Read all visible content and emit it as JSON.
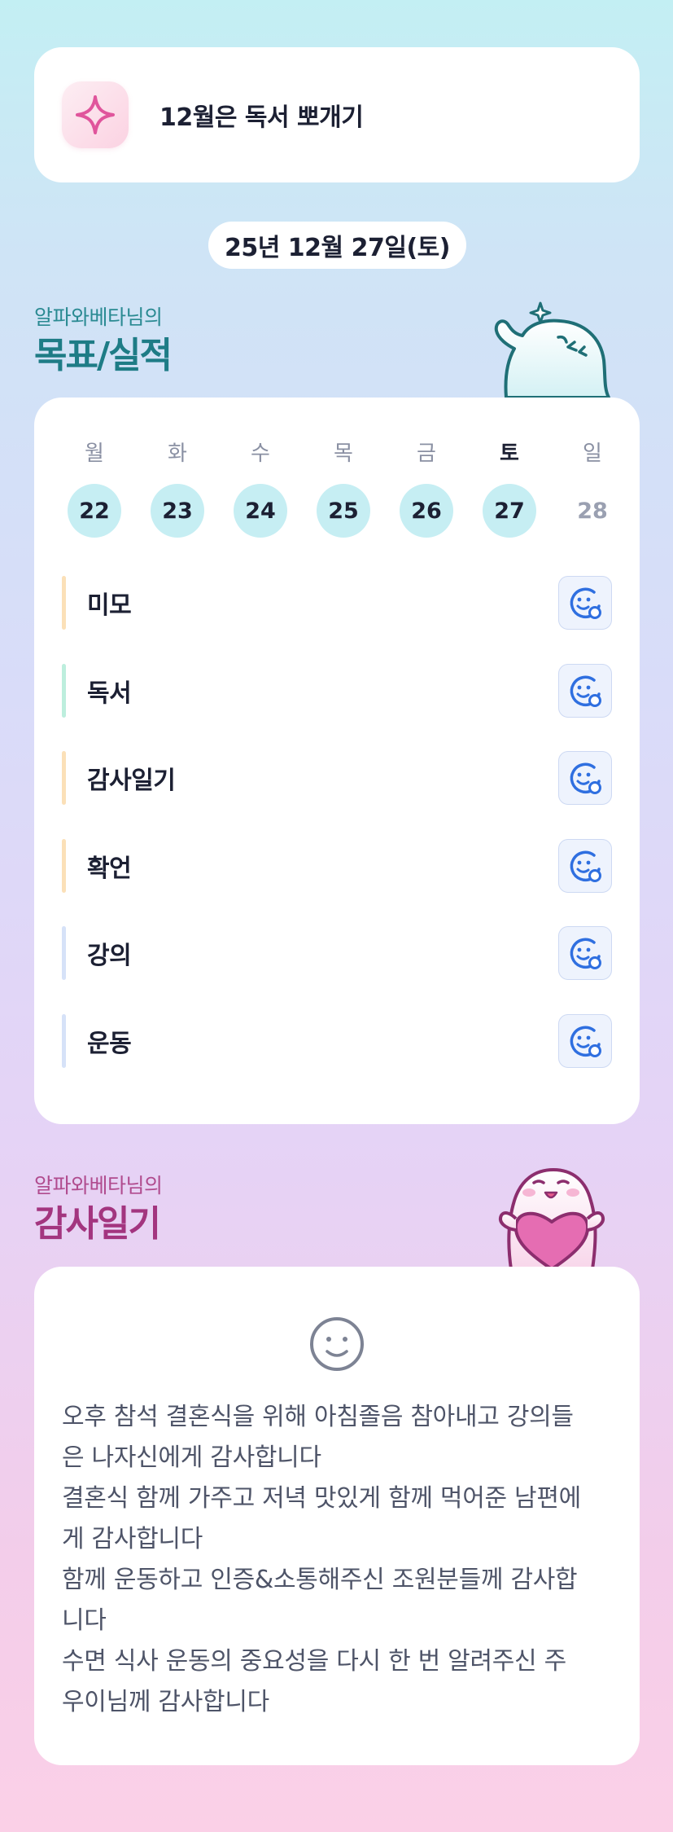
{
  "header": {
    "title": "12월은 독서 뽀개기",
    "icon": "sparkle-icon"
  },
  "date": "25년 12월 27일(토)",
  "goals_section": {
    "subtitle": "알파와베타님의",
    "title": "목표/실적"
  },
  "week": {
    "days": [
      {
        "name": "월",
        "date": "22",
        "state": "past"
      },
      {
        "name": "화",
        "date": "23",
        "state": "past"
      },
      {
        "name": "수",
        "date": "24",
        "state": "past"
      },
      {
        "name": "목",
        "date": "25",
        "state": "past"
      },
      {
        "name": "금",
        "date": "26",
        "state": "past"
      },
      {
        "name": "토",
        "date": "27",
        "state": "today"
      },
      {
        "name": "일",
        "date": "28",
        "state": "future"
      }
    ]
  },
  "goals": [
    {
      "label": "미모",
      "color": "#fbe0b8",
      "icon": "smile-add-icon"
    },
    {
      "label": "독서",
      "color": "#bdeedd",
      "icon": "smile-add-icon"
    },
    {
      "label": "감사일기",
      "color": "#fbe0b8",
      "icon": "smile-add-icon"
    },
    {
      "label": "확언",
      "color": "#fbe0b8",
      "icon": "smile-add-icon"
    },
    {
      "label": "강의",
      "color": "#d6e2f8",
      "icon": "smile-add-icon"
    },
    {
      "label": "운동",
      "color": "#d6e2f8",
      "icon": "smile-add-icon"
    }
  ],
  "gratitude_section": {
    "subtitle": "알파와베타님의",
    "title": "감사일기"
  },
  "gratitude": {
    "mood_icon": "smile-face-icon",
    "lines": [
      "오후 참석 결혼식을 위해 아침졸음 참아내고 강의들",
      "은 나자신에게 감사합니다",
      "결혼식 함께 가주고 저녁 맛있게 함께 먹어준 남편에",
      "게 감사합니다",
      "함께 운동하고 인증&소통해주신 조원분들께 감사합",
      "니다",
      "수면 식사 운동의 중요성을 다시 한 번 알려주신 주",
      "우이님께 감사합니다"
    ]
  },
  "colors": {
    "accent_teal": "#1e7c86",
    "accent_pink": "#a3357f",
    "day_circle": "#c6eef3",
    "button_icon": "#2f6fe0"
  }
}
